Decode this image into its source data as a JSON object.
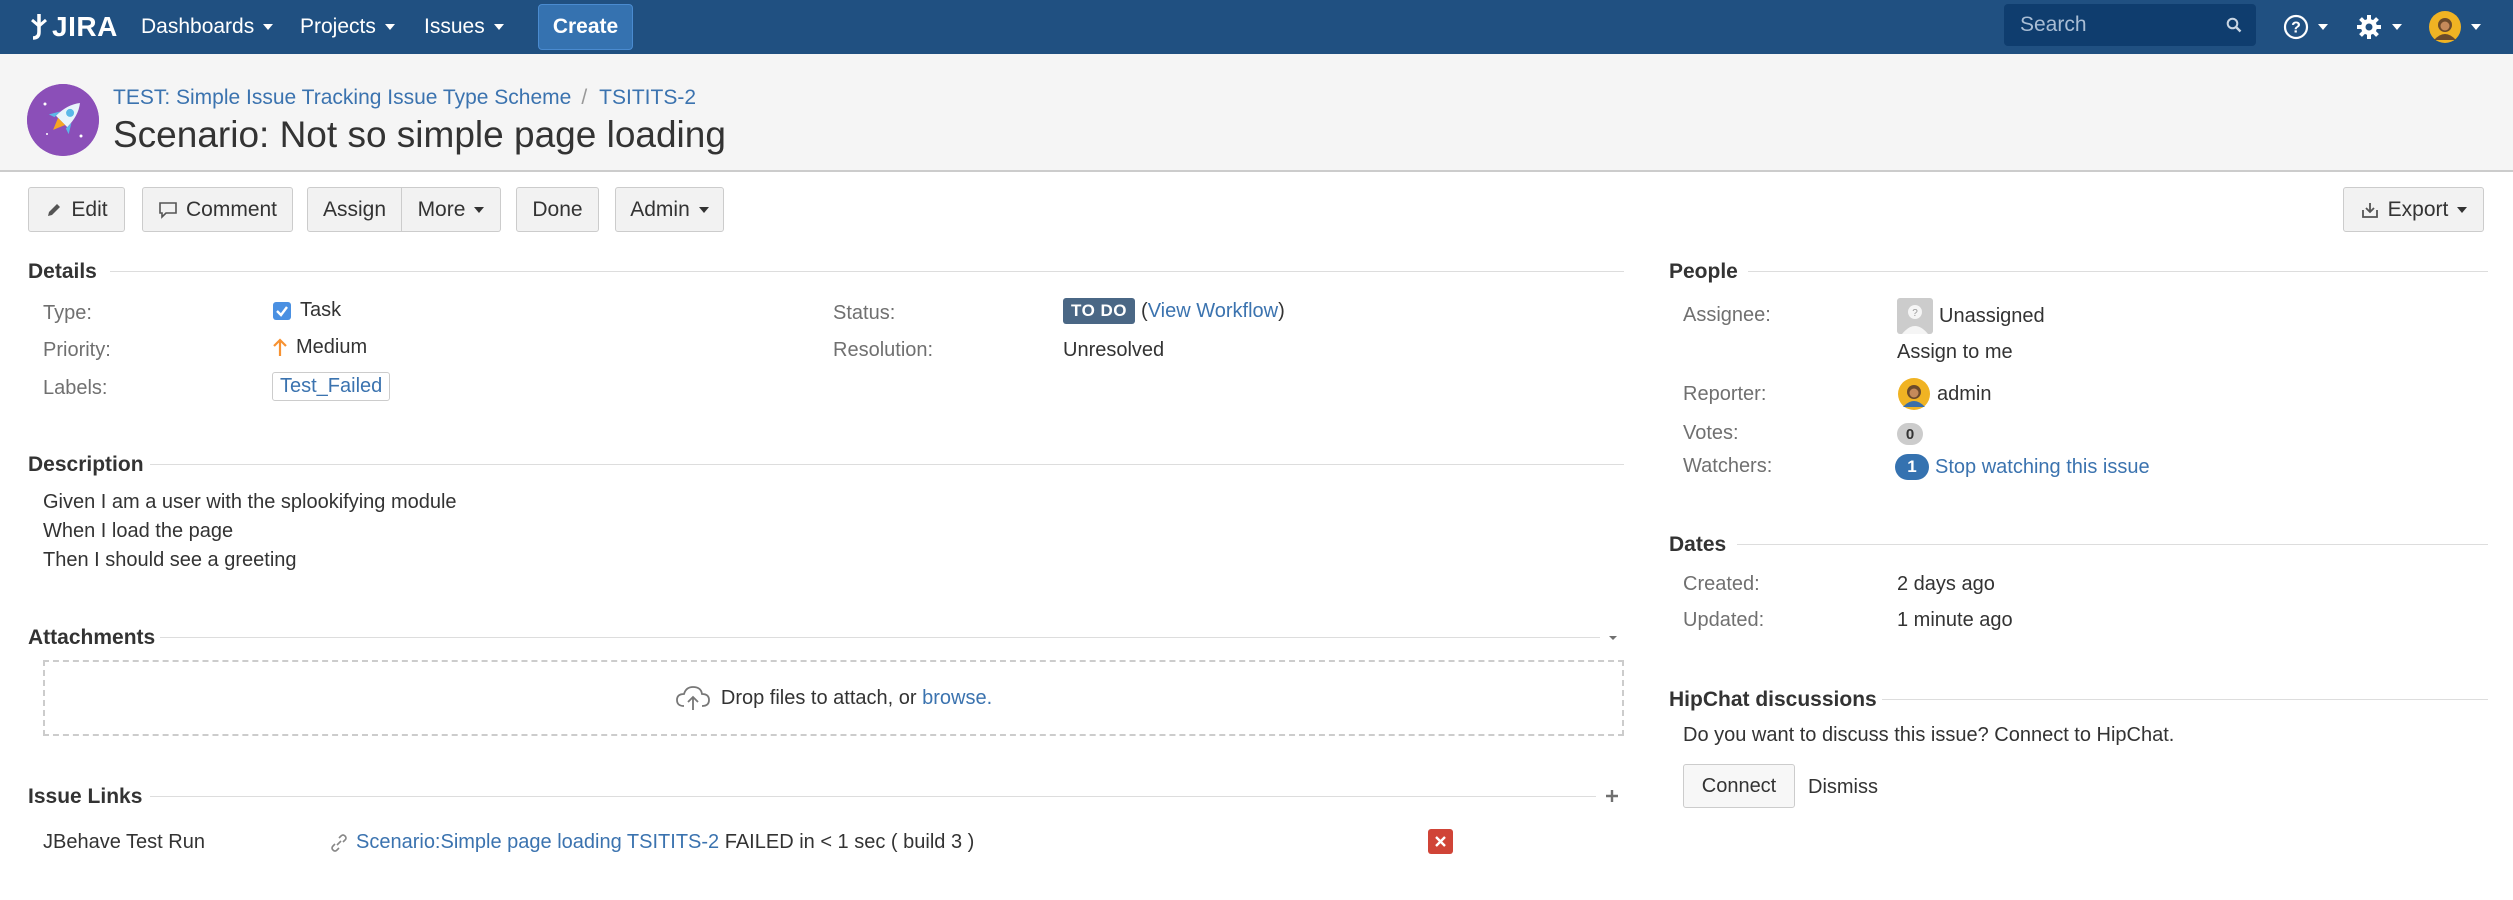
{
  "nav": {
    "logo_text": "JIRA",
    "items": [
      {
        "label": "Dashboards"
      },
      {
        "label": "Projects"
      },
      {
        "label": "Issues"
      }
    ],
    "create_label": "Create",
    "search_placeholder": "Search",
    "help_icon": "help-icon",
    "settings_icon": "gear-icon",
    "user_icon": "avatar"
  },
  "header": {
    "project_link": "TEST: Simple Issue Tracking Issue Type Scheme",
    "breadcrumb_sep": "/",
    "issue_key": "TSITITS-2",
    "title": "Scenario: Not so simple page loading"
  },
  "toolbar": {
    "edit": "Edit",
    "comment": "Comment",
    "assign": "Assign",
    "more": "More",
    "done": "Done",
    "admin": "Admin",
    "export": "Export"
  },
  "details": {
    "heading": "Details",
    "type_label": "Type:",
    "type_value": "Task",
    "priority_label": "Priority:",
    "priority_value": "Medium",
    "labels_label": "Labels:",
    "labels_value": "Test_Failed",
    "status_label": "Status:",
    "status_value": "TO DO",
    "view_workflow_open": "(",
    "view_workflow": "View Workflow",
    "view_workflow_close": ")",
    "resolution_label": "Resolution:",
    "resolution_value": "Unresolved"
  },
  "description": {
    "heading": "Description",
    "lines": [
      "Given I am a user with the splookifying module",
      "When I load the page",
      "Then I should see a greeting"
    ]
  },
  "attachments": {
    "heading": "Attachments",
    "drop_text": "Drop files to attach, or",
    "browse": "browse."
  },
  "issue_links": {
    "heading": "Issue Links",
    "rows": [
      {
        "type": "JBehave Test Run",
        "link_text": "Scenario:Simple page loading TSITITS-2",
        "result": "FAILED in < 1 sec ( build 3 )"
      }
    ]
  },
  "people": {
    "heading": "People",
    "assignee_label": "Assignee:",
    "assignee_value": "Unassigned",
    "assign_to_me": "Assign to me",
    "reporter_label": "Reporter:",
    "reporter_value": "admin",
    "votes_label": "Votes:",
    "votes_value": "0",
    "watchers_label": "Watchers:",
    "watchers_value": "1",
    "stop_watching": "Stop watching this issue"
  },
  "dates": {
    "heading": "Dates",
    "created_label": "Created:",
    "created_value": "2 days ago",
    "updated_label": "Updated:",
    "updated_value": "1 minute ago"
  },
  "hipchat": {
    "heading": "HipChat discussions",
    "prompt": "Do you want to discuss this issue? Connect to HipChat.",
    "connect": "Connect",
    "dismiss": "Dismiss"
  },
  "colors": {
    "nav_bg": "#205081",
    "create_bg": "#3572b0",
    "link": "#3b73af",
    "status_lozenge": "#4a6785",
    "remove_red": "#d04437"
  }
}
